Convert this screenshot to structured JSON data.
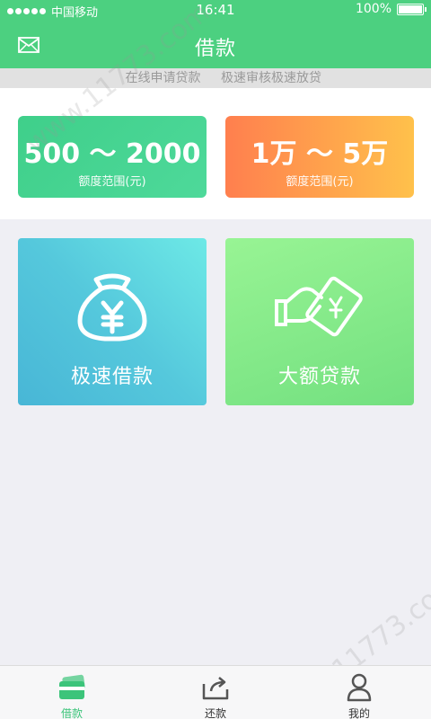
{
  "status_bar": {
    "carrier": "中国移动",
    "time": "16:41",
    "battery": "100%"
  },
  "header": {
    "title": "借款",
    "mail_icon": "mail-icon"
  },
  "marquee": {
    "items": [
      "在线申请贷款",
      "极速审核极速放贷"
    ]
  },
  "quota_cards": [
    {
      "range": "500 ～ 2000",
      "label": "额度范围(元)"
    },
    {
      "range": "1万 ～ 5万",
      "label": "额度范围(元)"
    }
  ],
  "loan_cards": [
    {
      "label": "极速借款",
      "icon": "money-bag-icon"
    },
    {
      "label": "大额贷款",
      "icon": "hand-money-icon"
    }
  ],
  "tab_bar": {
    "items": [
      {
        "label": "借款",
        "icon": "card-icon",
        "active": true
      },
      {
        "label": "还款",
        "icon": "share-icon",
        "active": false
      },
      {
        "label": "我的",
        "icon": "person-icon",
        "active": false
      }
    ]
  },
  "watermark": "www.11773.com",
  "colors": {
    "primary": "#4cd080",
    "active_tab": "#3cc47a",
    "orange_start": "#ff7f4e",
    "orange_end": "#ffc14b"
  }
}
